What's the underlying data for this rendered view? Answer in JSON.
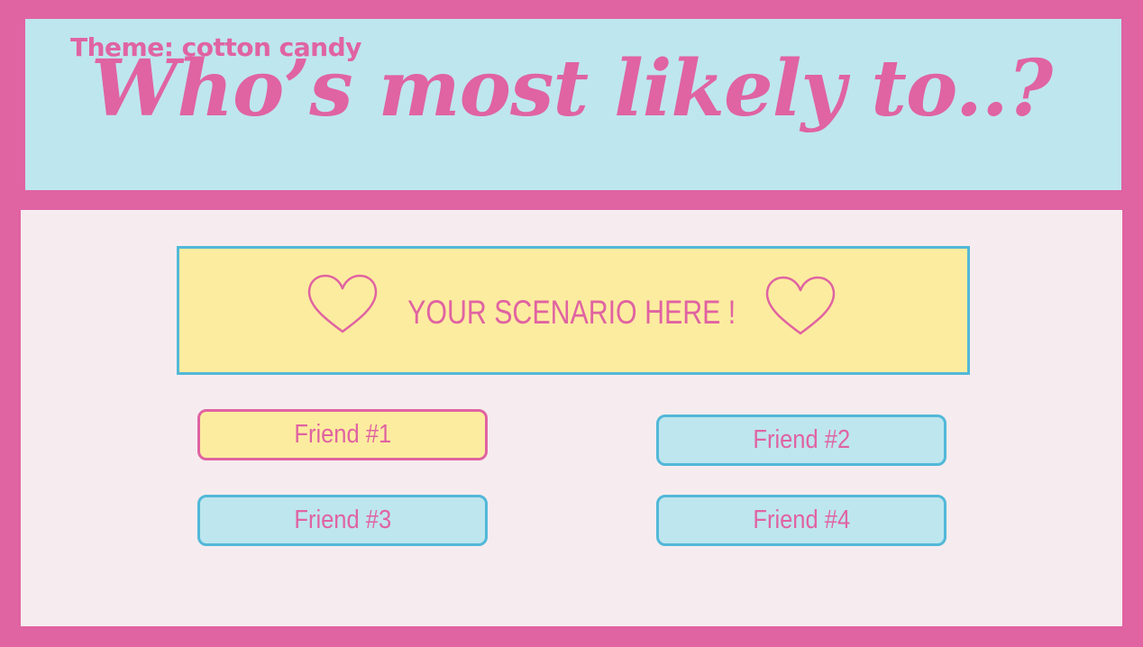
{
  "header": {
    "theme_label": "Theme: cotton candy",
    "title": "Who’s most likely to..?"
  },
  "scenario": {
    "text": "YOUR SCENARIO HERE !",
    "left_icon": "heart-outline-icon",
    "right_icon": "heart-outline-icon"
  },
  "friends": [
    {
      "label": "Friend #1",
      "selected": true
    },
    {
      "label": "Friend #2",
      "selected": false
    },
    {
      "label": "Friend #3",
      "selected": false
    },
    {
      "label": "Friend #4",
      "selected": false
    }
  ],
  "colors": {
    "frame": "#e063a2",
    "header_bg": "#bee6ee",
    "content_bg": "#f6ecef",
    "scenario_bg": "#fcec9f",
    "accent_blue": "#52b8d8",
    "text_pink": "#e063a2"
  }
}
